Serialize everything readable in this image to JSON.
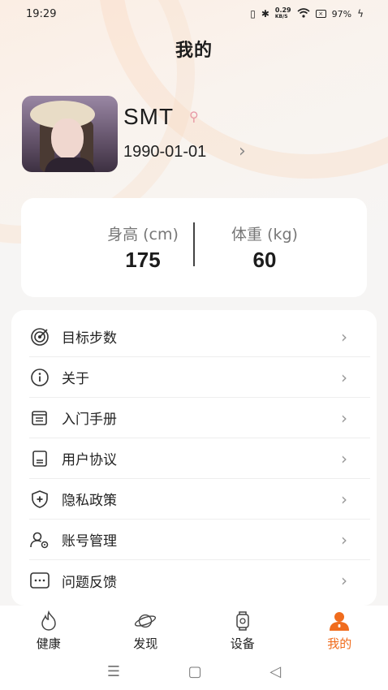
{
  "status_bar": {
    "time": "19:29",
    "network_speed_value": "0.29",
    "network_speed_unit": "KB/S",
    "battery": "97%"
  },
  "page_title": "我的",
  "profile": {
    "name": "SMT",
    "birthday": "1990-01-01",
    "gender_icon": "female-symbol-icon"
  },
  "stats": {
    "height_label": "身高 (cm)",
    "height_value": "175",
    "weight_label": "体重 (kg)",
    "weight_value": "60"
  },
  "menu": {
    "items": [
      {
        "label": "目标步数",
        "icon": "target-icon"
      },
      {
        "label": "关于",
        "icon": "info-icon"
      },
      {
        "label": "入门手册",
        "icon": "manual-icon"
      },
      {
        "label": "用户协议",
        "icon": "agreement-icon"
      },
      {
        "label": "隐私政策",
        "icon": "shield-plus-icon"
      },
      {
        "label": "账号管理",
        "icon": "account-settings-icon"
      },
      {
        "label": "问题反馈",
        "icon": "feedback-icon"
      }
    ]
  },
  "tabs": [
    {
      "label": "健康",
      "icon": "flame-icon"
    },
    {
      "label": "发现",
      "icon": "planet-icon"
    },
    {
      "label": "设备",
      "icon": "watch-icon"
    },
    {
      "label": "我的",
      "icon": "person-icon",
      "active": true
    }
  ],
  "colors": {
    "accent": "#f06c1d",
    "background": "#f6f5f4",
    "card": "#ffffff"
  }
}
